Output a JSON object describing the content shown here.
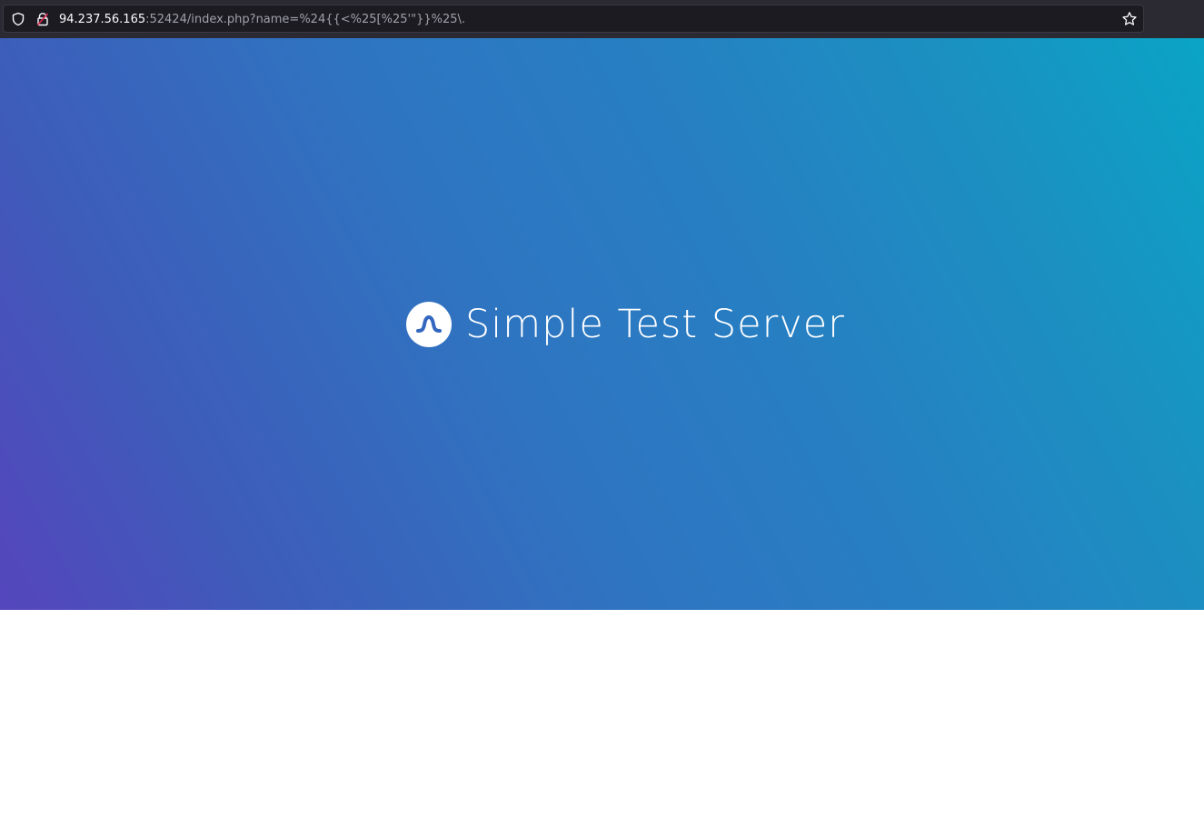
{
  "browser": {
    "url_host": "94.237.56.165",
    "url_rest": ":52424/index.php?name=%24{{<%25[%25'\"}}%25\\.",
    "icons": [
      "shield-icon",
      "lock-icon",
      "star-icon"
    ]
  },
  "page": {
    "title": "Simple Test Server",
    "logo_icon": "wave-logo-icon",
    "colors": {
      "gradient_start": "#5545bc",
      "gradient_end": "#0aa4c6",
      "logo_mark": "#3467bf"
    }
  }
}
